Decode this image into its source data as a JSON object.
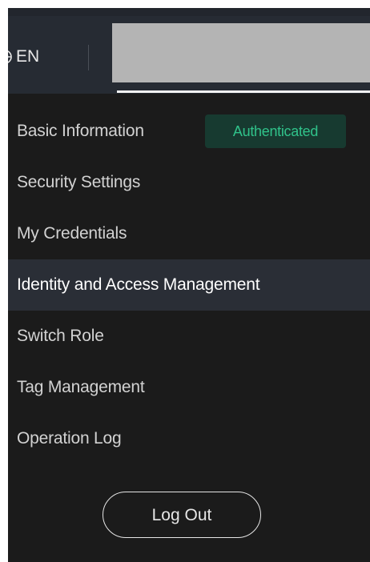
{
  "header": {
    "language": "EN",
    "language_icon": "globe-icon"
  },
  "menu": {
    "items": [
      {
        "label": "Basic Information",
        "badge": "Authenticated"
      },
      {
        "label": "Security Settings"
      },
      {
        "label": "My Credentials"
      },
      {
        "label": "Identity and Access Management",
        "active": true
      },
      {
        "label": "Switch Role"
      },
      {
        "label": "Tag Management"
      },
      {
        "label": "Operation Log"
      }
    ]
  },
  "logout_label": "Log Out",
  "colors": {
    "menu_background": "#1b1b1b",
    "header_background": "#262b33",
    "active_item_background": "#2a2e36",
    "badge_background": "#173a30",
    "badge_text": "#30c28a"
  }
}
